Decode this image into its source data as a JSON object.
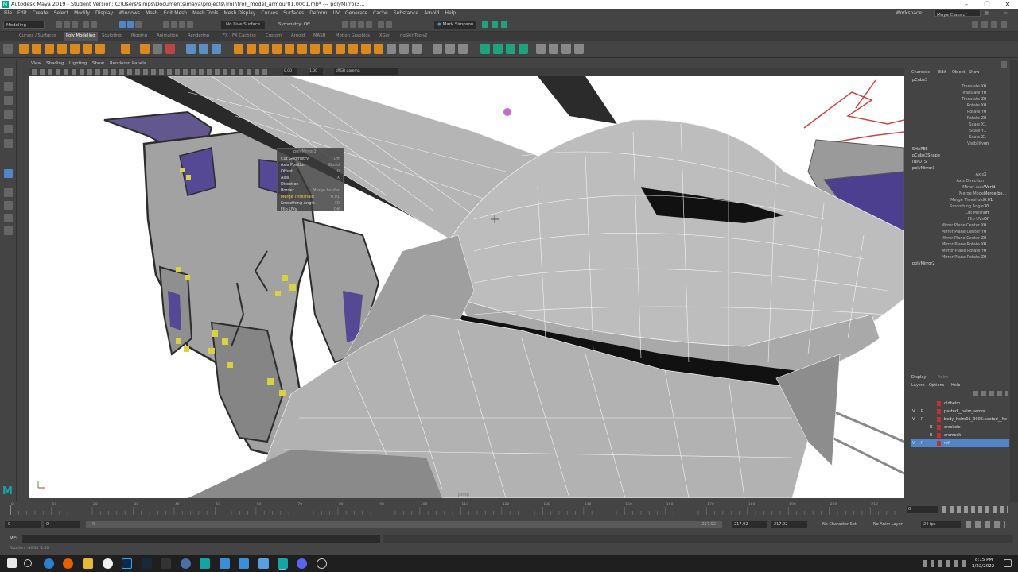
{
  "window": {
    "title": "Autodesk Maya 2019 - Student Version: C:\\Users\\simps\\Documents\\maya\\projects\\Troll\\troll_model_armour01.0001.mb*   ---   polyMirror3..."
  },
  "menubar": {
    "items": [
      "File",
      "Edit",
      "Create",
      "Select",
      "Modify",
      "Display",
      "Windows",
      "Mesh",
      "Edit Mesh",
      "Mesh Tools",
      "Mesh Display",
      "Curves",
      "Surfaces",
      "Deform",
      "UV",
      "Generate",
      "Cache",
      "Substance",
      "Arnold",
      "Help"
    ],
    "workspace_label": "Workspace:",
    "workspace_value": "Maya Classic*"
  },
  "statusline": {
    "mode": "Modeling",
    "live_surface": "No Live Surface",
    "symmetry": "Symmetry: Off",
    "user": "Mark Simpson"
  },
  "shelf_tabs": [
    "Curves / Surfaces",
    "Poly Modeling",
    "Sculpting",
    "Rigging",
    "Animation",
    "Rendering",
    "FX",
    "FX Caching",
    "Custom",
    "Arnold",
    "MASH",
    "Motion Graphics",
    "XGen",
    "ngSkinTools2"
  ],
  "shelf_active": "Poly Modeling",
  "panel_menu": [
    "View",
    "Shading",
    "Lighting",
    "Show",
    "Renderer",
    "Panels"
  ],
  "panel_toolbar": {
    "near": "0.00",
    "far": "1.00",
    "colorspace": "sRGB gamma"
  },
  "viewport": {
    "camera_label": "persp"
  },
  "hud": {
    "title": "polyMirror3",
    "rows": [
      {
        "label": "Cut Geometry",
        "value": "Off"
      },
      {
        "label": "Axis Position",
        "value": "World"
      },
      {
        "label": "Offset",
        "value": "0"
      },
      {
        "label": "Axis",
        "value": "X"
      },
      {
        "label": "Direction",
        "value": ""
      },
      {
        "label": "Border",
        "value": "Merge border"
      },
      {
        "label": "Merge Threshold",
        "value": "0.01"
      },
      {
        "label": "Smoothing Angle",
        "value": "30"
      },
      {
        "label": "Flip UVs",
        "value": "Off"
      }
    ]
  },
  "channel_box": {
    "tabs": [
      "Channels",
      "Edit",
      "Object",
      "Show"
    ],
    "object": "pCube3",
    "transform": [
      {
        "label": "Translate X",
        "value": "0"
      },
      {
        "label": "Translate Y",
        "value": "0"
      },
      {
        "label": "Translate Z",
        "value": "0"
      },
      {
        "label": "Rotate X",
        "value": "0"
      },
      {
        "label": "Rotate Y",
        "value": "0"
      },
      {
        "label": "Rotate Z",
        "value": "0"
      },
      {
        "label": "Scale X",
        "value": "1"
      },
      {
        "label": "Scale Y",
        "value": "1"
      },
      {
        "label": "Scale Z",
        "value": "1"
      },
      {
        "label": "Visibility",
        "value": "on"
      }
    ],
    "shapes_header": "SHAPES",
    "shape": "pCube3Shape",
    "inputs_header": "INPUTS",
    "input": "polyMirror3",
    "mirror": [
      {
        "label": "Axis",
        "value": "X"
      },
      {
        "label": "Axis Direction",
        "value": ""
      },
      {
        "label": "Mirror Axis",
        "value": "World"
      },
      {
        "label": "Merge Mode",
        "value": "Merge bo..."
      },
      {
        "label": "Merge Threshold",
        "value": "0.01"
      },
      {
        "label": "Smoothing Angle",
        "value": "30"
      },
      {
        "label": "Cut Mesh",
        "value": "off"
      },
      {
        "label": "Flip UVs",
        "value": "Off"
      },
      {
        "label": "Mirror Plane Center X",
        "value": "0"
      },
      {
        "label": "Mirror Plane Center Y",
        "value": "0"
      },
      {
        "label": "Mirror Plane Center Z",
        "value": "0"
      },
      {
        "label": "Mirror Plane Rotate X",
        "value": "0"
      },
      {
        "label": "Mirror Plane Rotate Y",
        "value": "0"
      },
      {
        "label": "Mirror Plane Rotate Z",
        "value": "0"
      }
    ],
    "input2": "polyMirror2"
  },
  "layer_editor": {
    "tabs": [
      "Display",
      "Anim"
    ],
    "menu": [
      "Layers",
      "Options",
      "Help"
    ],
    "layers": [
      {
        "v": "",
        "p": "",
        "r": "",
        "name": "oldhelm",
        "color": "#c03030",
        "selected": false
      },
      {
        "v": "V",
        "p": "P",
        "r": "",
        "name": "pasted__helm_armor",
        "color": "#c03030",
        "selected": false
      },
      {
        "v": "V",
        "p": "P",
        "r": "",
        "name": "body_helm01_0006:pasted__he",
        "color": "#c03030",
        "selected": false
      },
      {
        "v": "",
        "p": "",
        "r": "R",
        "name": "orcskele",
        "color": "#c03030",
        "selected": false
      },
      {
        "v": "",
        "p": "",
        "r": "R",
        "name": "orcmesh",
        "color": "#c03030",
        "selected": false
      },
      {
        "v": "V",
        "p": "P",
        "r": "",
        "name": "ref",
        "color": "#c03030",
        "selected": true
      }
    ]
  },
  "time_slider": {
    "ticks": [
      "0",
      "10",
      "20",
      "30",
      "40",
      "50",
      "60",
      "70",
      "80",
      "90",
      "100",
      "110",
      "120",
      "130",
      "140",
      "150",
      "160",
      "170",
      "180",
      "190",
      "200",
      "210"
    ],
    "current": "0"
  },
  "range_slider": {
    "start": "0",
    "inner_start": "0",
    "inner_label": "0",
    "inner_end": "217.92",
    "end": "217.92",
    "end2": "217.92",
    "character_set": "No Character Set",
    "anim_layer": "No Anim Layer",
    "fps": "24 fps"
  },
  "command_line": {
    "label": "MEL",
    "value": ""
  },
  "help_line": "Rotation: -46.38   -1.40",
  "taskbar": {
    "time": "8:15 PM",
    "date": "3/22/2022"
  },
  "colors": {
    "accent_blue": "#4d87c7",
    "selection_blue": "#5285c7",
    "layer_red": "#c03030",
    "maya_teal": "#16a3a3"
  }
}
